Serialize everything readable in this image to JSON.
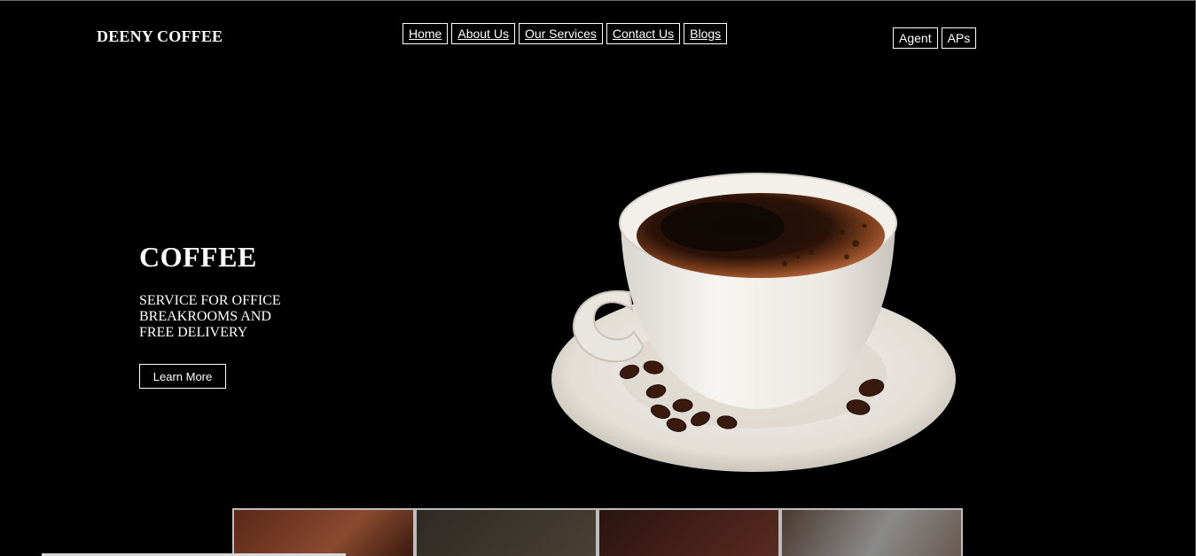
{
  "brand": "DEENY COFFEE",
  "nav": {
    "home": "Home",
    "about": "About Us",
    "services": "Our Services",
    "contact": "Contact Us",
    "blogs": "Blogs"
  },
  "side": {
    "agent": "Agent",
    "aps": "APs"
  },
  "hero": {
    "title": "COFFEE",
    "subtitle": "SERVICE FOR OFFICE BREAKROOMS AND FREE DELIVERY",
    "cta": "Learn More"
  },
  "colors": {
    "background": "#000000",
    "text": "#ffffff",
    "coffee": "#3a1a0c",
    "crema": "#b8683a",
    "cup": "#f2efea"
  },
  "icons": [
    "coffee-cup-illustration",
    "coffee-bean-icon"
  ]
}
